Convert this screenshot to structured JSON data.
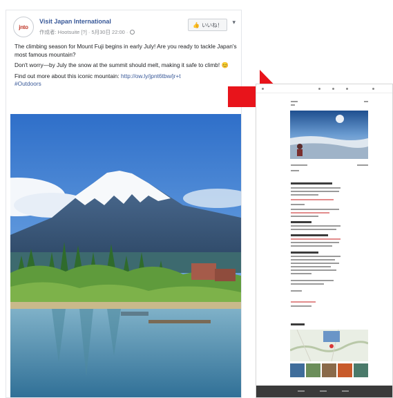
{
  "post": {
    "page_name": "Visit Japan International",
    "avatar_text": "jnto",
    "meta": "作成者: Hootsuite [?] · 5月30日 22:00 ·",
    "like_button": "いいね！",
    "more": "▾",
    "paragraphs": [
      "The climbing season for Mount Fuji begins in early July! Are you ready to tackle Japan's most famous mountain?",
      "Don't worry—by July the snow at the summit should melt, making it safe to climb! 😊"
    ],
    "link_prefix": "Find out more about this iconic mountain: ",
    "link_url": "http://ow.ly/jpnt6tbw/jr+t",
    "hashtag": "#Outdoors"
  },
  "colors": {
    "arrow": "#e8141b",
    "link": "#385898",
    "fb_text": "#1c1e21",
    "phone_footer": "#3a3a3a"
  },
  "icons": {
    "arrow": "right-arrow-icon",
    "globe": "globe-icon",
    "thumb": "thumbs-up-icon"
  }
}
